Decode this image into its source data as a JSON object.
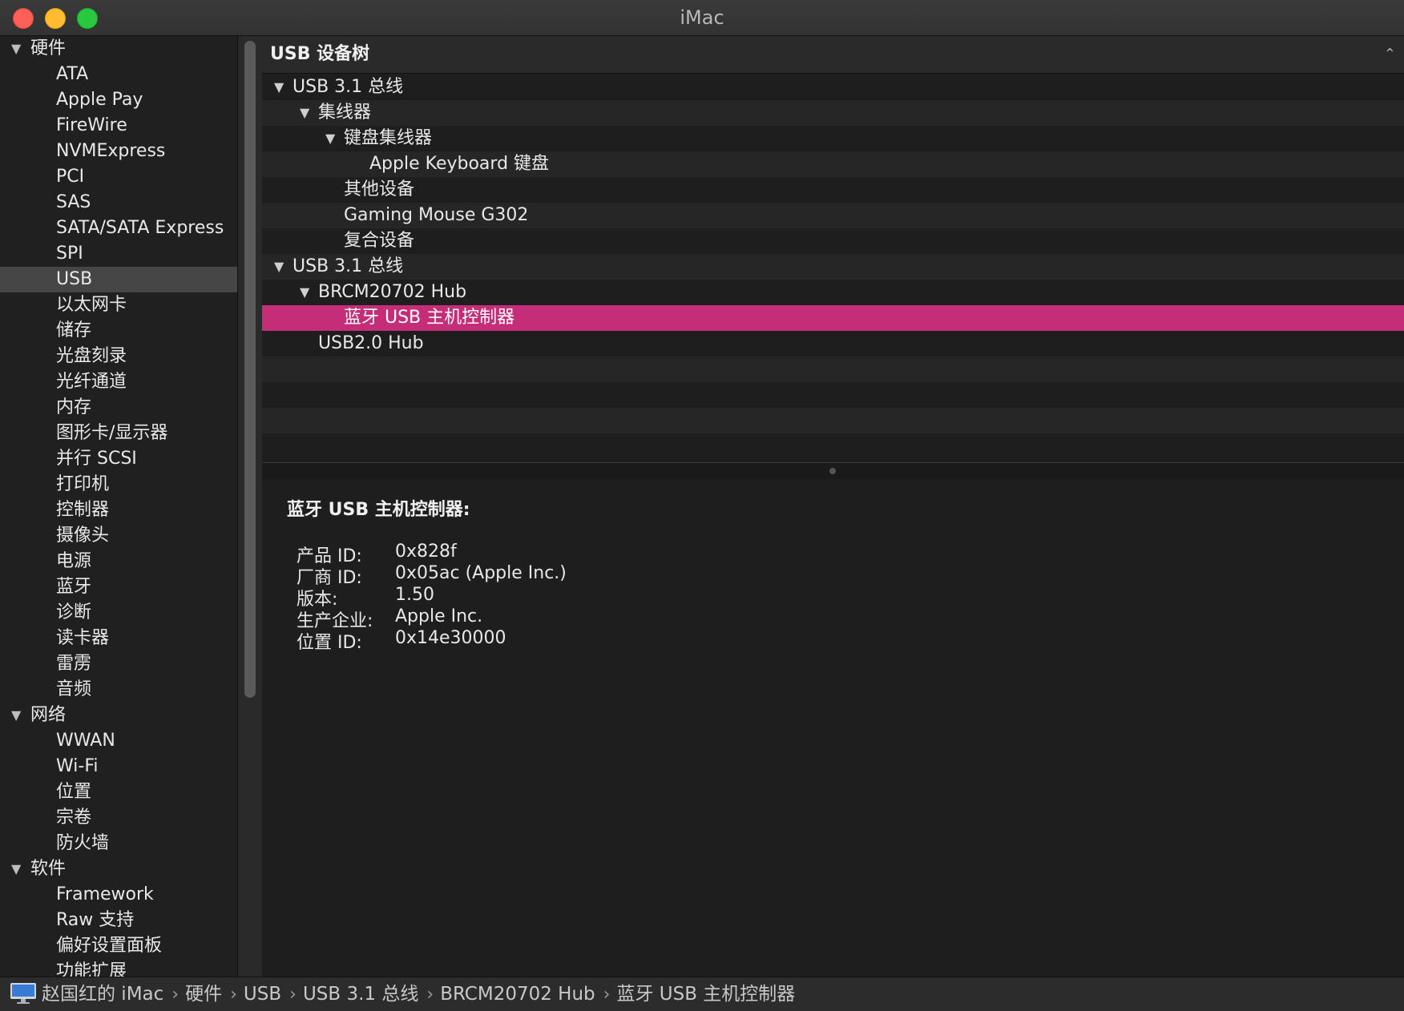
{
  "window": {
    "title": "iMac"
  },
  "sidebar": {
    "rows": [
      {
        "label": "硬件",
        "level": 0,
        "expanded": true
      },
      {
        "label": "ATA",
        "level": 1
      },
      {
        "label": "Apple Pay",
        "level": 1
      },
      {
        "label": "FireWire",
        "level": 1
      },
      {
        "label": "NVMExpress",
        "level": 1
      },
      {
        "label": "PCI",
        "level": 1
      },
      {
        "label": "SAS",
        "level": 1
      },
      {
        "label": "SATA/SATA Express",
        "level": 1
      },
      {
        "label": "SPI",
        "level": 1
      },
      {
        "label": "USB",
        "level": 1,
        "selected": true
      },
      {
        "label": "以太网卡",
        "level": 1
      },
      {
        "label": "储存",
        "level": 1
      },
      {
        "label": "光盘刻录",
        "level": 1
      },
      {
        "label": "光纤通道",
        "level": 1
      },
      {
        "label": "内存",
        "level": 1
      },
      {
        "label": "图形卡/显示器",
        "level": 1
      },
      {
        "label": "并行 SCSI",
        "level": 1
      },
      {
        "label": "打印机",
        "level": 1
      },
      {
        "label": "控制器",
        "level": 1
      },
      {
        "label": "摄像头",
        "level": 1
      },
      {
        "label": "电源",
        "level": 1
      },
      {
        "label": "蓝牙",
        "level": 1
      },
      {
        "label": "诊断",
        "level": 1
      },
      {
        "label": "读卡器",
        "level": 1
      },
      {
        "label": "雷雳",
        "level": 1
      },
      {
        "label": "音频",
        "level": 1
      },
      {
        "label": "网络",
        "level": 0,
        "expanded": true
      },
      {
        "label": "WWAN",
        "level": 1
      },
      {
        "label": "Wi-Fi",
        "level": 1
      },
      {
        "label": "位置",
        "level": 1
      },
      {
        "label": "宗卷",
        "level": 1
      },
      {
        "label": "防火墙",
        "level": 1
      },
      {
        "label": "软件",
        "level": 0,
        "expanded": true
      },
      {
        "label": "Framework",
        "level": 1
      },
      {
        "label": "Raw 支持",
        "level": 1
      },
      {
        "label": "偏好设置面板",
        "level": 1
      },
      {
        "label": "功能扩展",
        "level": 1
      }
    ]
  },
  "tree": {
    "header": "USB 设备树",
    "rows": [
      {
        "label": "USB 3.1 总线",
        "level": 0,
        "expanded": true
      },
      {
        "label": "集线器",
        "level": 1,
        "expanded": true
      },
      {
        "label": "键盘集线器",
        "level": 2,
        "expanded": true
      },
      {
        "label": "Apple Keyboard 键盘",
        "level": 3
      },
      {
        "label": "其他设备",
        "level": 2
      },
      {
        "label": "Gaming Mouse G302",
        "level": 2
      },
      {
        "label": "复合设备",
        "level": 2
      },
      {
        "label": "USB 3.1 总线",
        "level": 0,
        "expanded": true
      },
      {
        "label": "BRCM20702 Hub",
        "level": 1,
        "expanded": true
      },
      {
        "label": "蓝牙 USB 主机控制器",
        "level": 2,
        "selected": true
      },
      {
        "label": "USB2.0 Hub",
        "level": 1
      },
      {
        "label": "",
        "level": 0
      },
      {
        "label": "",
        "level": 0
      },
      {
        "label": "",
        "level": 0
      },
      {
        "label": "",
        "level": 0
      }
    ],
    "selected_color": "#c52d79"
  },
  "detail": {
    "title": "蓝牙 USB 主机控制器:",
    "properties": [
      {
        "key": "产品 ID:",
        "value": "0x828f"
      },
      {
        "key": "厂商 ID:",
        "value": "0x05ac (Apple Inc.)"
      },
      {
        "key": "版本:",
        "value": "1.50"
      },
      {
        "key": "生产企业:",
        "value": "Apple Inc."
      },
      {
        "key": "位置 ID:",
        "value": "0x14e30000"
      }
    ]
  },
  "statusbar": {
    "icon": "imac-icon",
    "crumbs": [
      "赵国红的 iMac",
      "硬件",
      "USB",
      "USB 3.1 总线",
      "BRCM20702 Hub",
      "蓝牙 USB 主机控制器"
    ]
  }
}
